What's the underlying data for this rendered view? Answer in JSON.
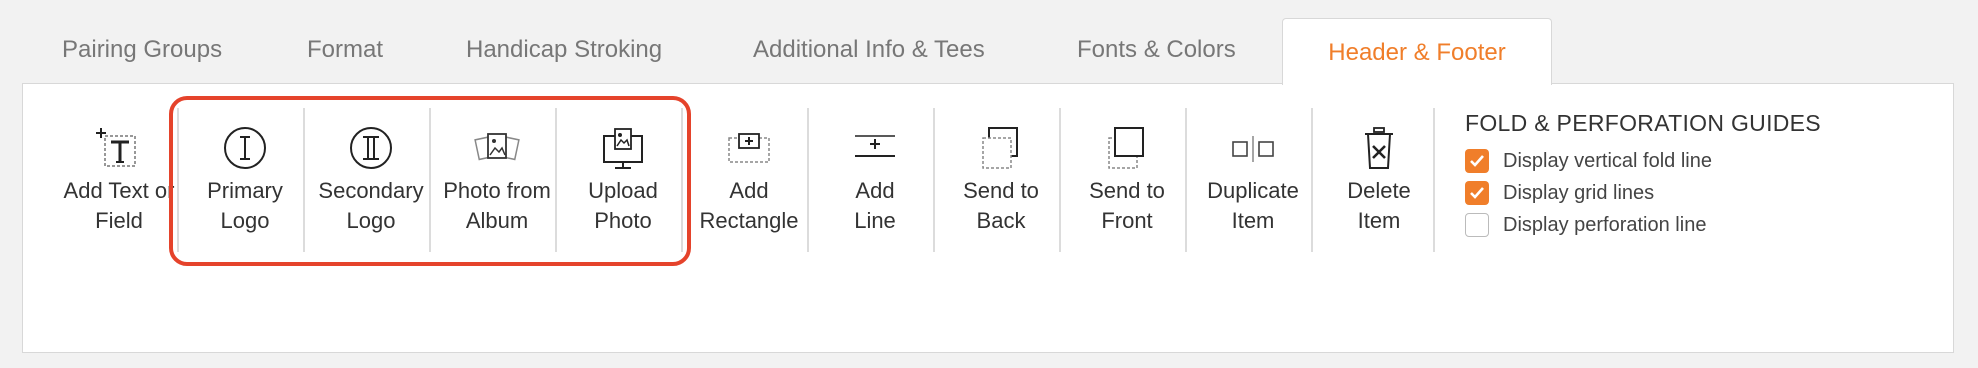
{
  "tabs": [
    {
      "label": "Pairing Groups",
      "active": false
    },
    {
      "label": "Format",
      "active": false
    },
    {
      "label": "Handicap Stroking",
      "active": false
    },
    {
      "label": "Additional Info & Tees",
      "active": false
    },
    {
      "label": "Fonts & Colors",
      "active": false
    },
    {
      "label": "Header & Footer",
      "active": true
    }
  ],
  "toolbar": {
    "tools": [
      {
        "label": "Add Text or\nField",
        "icon": "add-text-icon"
      },
      {
        "label": "Primary\nLogo",
        "icon": "primary-logo-icon"
      },
      {
        "label": "Secondary\nLogo",
        "icon": "secondary-logo-icon"
      },
      {
        "label": "Photo from\nAlbum",
        "icon": "photo-album-icon"
      },
      {
        "label": "Upload\nPhoto",
        "icon": "upload-photo-icon"
      },
      {
        "label": "Add\nRectangle",
        "icon": "add-rectangle-icon"
      },
      {
        "label": "Add\nLine",
        "icon": "add-line-icon"
      },
      {
        "label": "Send to\nBack",
        "icon": "send-to-back-icon"
      },
      {
        "label": "Send to\nFront",
        "icon": "send-to-front-icon"
      },
      {
        "label": "Duplicate\nItem",
        "icon": "duplicate-icon"
      },
      {
        "label": "Delete\nItem",
        "icon": "trash-icon"
      }
    ]
  },
  "guides": {
    "title": "FOLD & PERFORATION GUIDES",
    "options": [
      {
        "label": "Display vertical fold line",
        "checked": true
      },
      {
        "label": "Display grid lines",
        "checked": true
      },
      {
        "label": "Display perforation line",
        "checked": false
      }
    ]
  },
  "colors": {
    "accent": "#f07e2a",
    "highlight": "#e5432b"
  }
}
